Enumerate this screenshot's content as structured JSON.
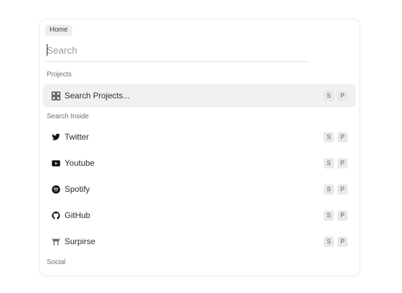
{
  "breadcrumb": {
    "label": "Home"
  },
  "search": {
    "placeholder": "Search",
    "value": ""
  },
  "sections": {
    "projects": "Projects",
    "search_inside": "Search Inside",
    "social": "Social"
  },
  "items": [
    {
      "label": "Search Projects...",
      "icon": "grid-icon",
      "keys": [
        "S",
        "P"
      ],
      "selected": true
    },
    {
      "label": "Twitter",
      "icon": "twitter-icon",
      "keys": [
        "S",
        "P"
      ]
    },
    {
      "label": "Youtube",
      "icon": "youtube-icon",
      "keys": [
        "S",
        "P"
      ]
    },
    {
      "label": "Spotify",
      "icon": "spotify-icon",
      "keys": [
        "S",
        "P"
      ]
    },
    {
      "label": "GitHub",
      "icon": "github-icon",
      "keys": [
        "S",
        "P"
      ]
    },
    {
      "label": "Surpirse",
      "icon": "torii-icon",
      "keys": [
        "S",
        "P"
      ]
    }
  ]
}
